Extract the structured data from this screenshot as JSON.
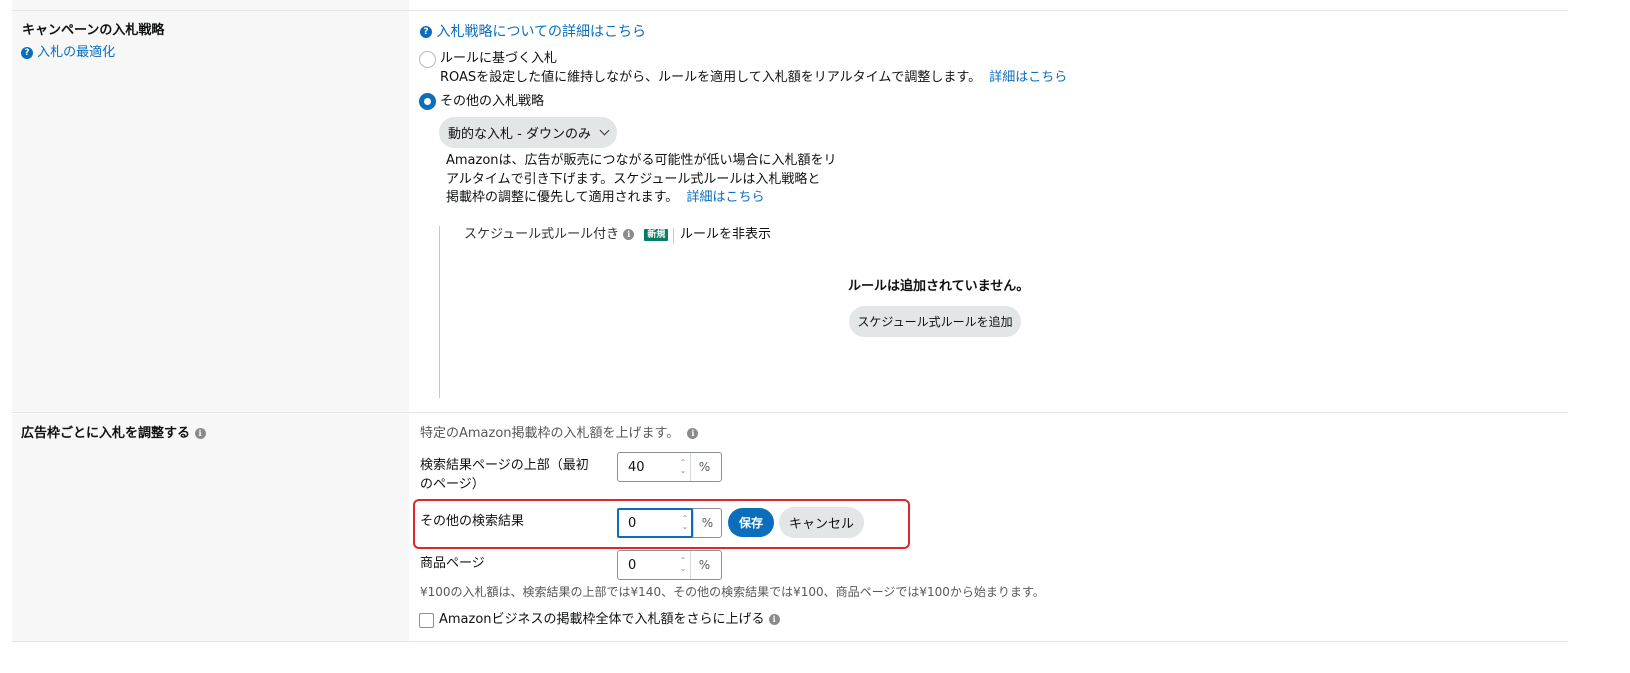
{
  "bidding": {
    "title": "キャンペーンの入札戦略",
    "help_link": "入札の最適化",
    "details_link": "入札戦略についての詳細はこちら",
    "rule_option": {
      "label": "ルールに基づく入札",
      "description": "ROASを設定した値に維持しながら、ルールを適用して入札額をリアルタイムで調整します。",
      "details_link": "詳細はこちら"
    },
    "other_option": {
      "label": "その他の入札戦略",
      "dropdown_value": "動的な入札 - ダウンのみ",
      "description_line1": "Amazonは、広告が販売につながる可能性が低い場合に入札額をリ",
      "description_line2": "アルタイムで引き下げます。スケジュール式ルールは入札戦略と",
      "description_line3": "掲載枠の調整に優先して適用されます。",
      "details_link": "詳細はこちら"
    },
    "schedule": {
      "label": "スケジュール式ルール付き",
      "badge": "新規",
      "hide_link": "ルールを非表示",
      "empty_text": "ルールは追加されていません。",
      "add_button": "スケジュール式ルールを追加"
    }
  },
  "placement": {
    "title": "広告枠ごとに入札を調整する",
    "intro": "特定のAmazon掲載枠の入札額を上げます。",
    "rows": [
      {
        "label_line1": "検索結果ページの上部（最初",
        "label_line2": "のページ）",
        "value": "40",
        "unit": "%"
      },
      {
        "label_line1": "その他の検索結果",
        "label_line2": "",
        "value": "0",
        "unit": "%"
      },
      {
        "label_line1": "商品ページ",
        "label_line2": "",
        "value": "0",
        "unit": "%"
      }
    ],
    "save_button": "保存",
    "cancel_button": "キャンセル",
    "example_text": "¥100の入札額は、検索結果の上部では¥140、その他の検索結果では¥100、商品ページでは¥100から始まります。",
    "business_checkbox": "Amazonビジネスの掲載枠全体で入札額をさらに上げる"
  }
}
